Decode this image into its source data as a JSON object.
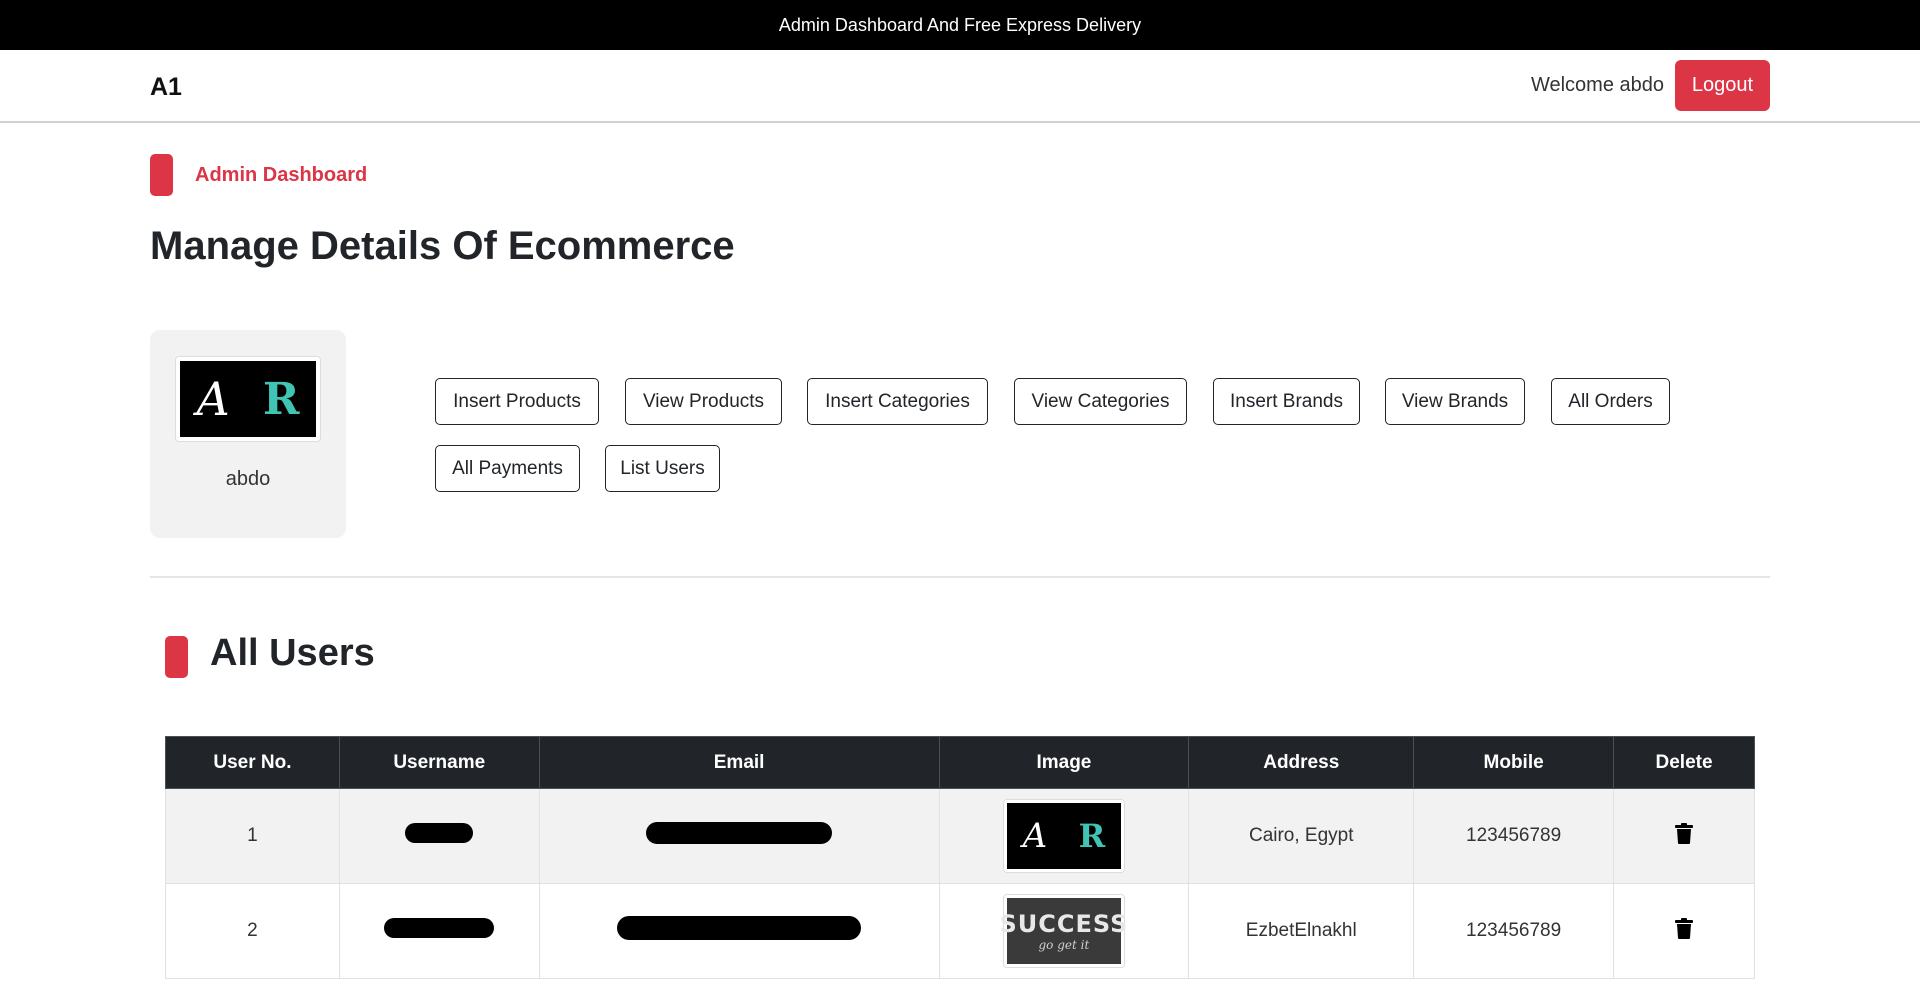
{
  "announcement": "Admin Dashboard And Free Express Delivery",
  "navbar": {
    "brand": "A1",
    "welcome": "Welcome abdo",
    "logout_label": "Logout"
  },
  "dashboard": {
    "eyebrow": "Admin Dashboard",
    "title": "Manage Details Of Ecommerce"
  },
  "profile": {
    "name": "abdo",
    "image_letters": [
      "A",
      "R"
    ]
  },
  "actions": [
    "Insert Products",
    "View Products",
    "Insert Categories",
    "View Categories",
    "Insert Brands",
    "View Brands",
    "All Orders",
    "All Payments",
    "List Users"
  ],
  "users_section": {
    "title": "All Users",
    "columns": [
      "User No.",
      "Username",
      "Email",
      "Image",
      "Address",
      "Mobile",
      "Delete"
    ],
    "rows": [
      {
        "no": "1",
        "username": "",
        "email": "",
        "image": "monogram-AR",
        "image_letters": [
          "A",
          "R"
        ],
        "address": "Cairo, Egypt",
        "mobile": "123456789"
      },
      {
        "no": "2",
        "username": "",
        "email": "",
        "image": "success-chalkboard",
        "image_text": "SUCCESS",
        "image_subtext": "go get it",
        "address": "EzbetElnakhl",
        "mobile": "123456789"
      }
    ]
  },
  "colors": {
    "accent": "#dc3545",
    "header_dark": "#212529",
    "topbar": "#000000"
  },
  "icons": {
    "delete": "trash-icon"
  }
}
